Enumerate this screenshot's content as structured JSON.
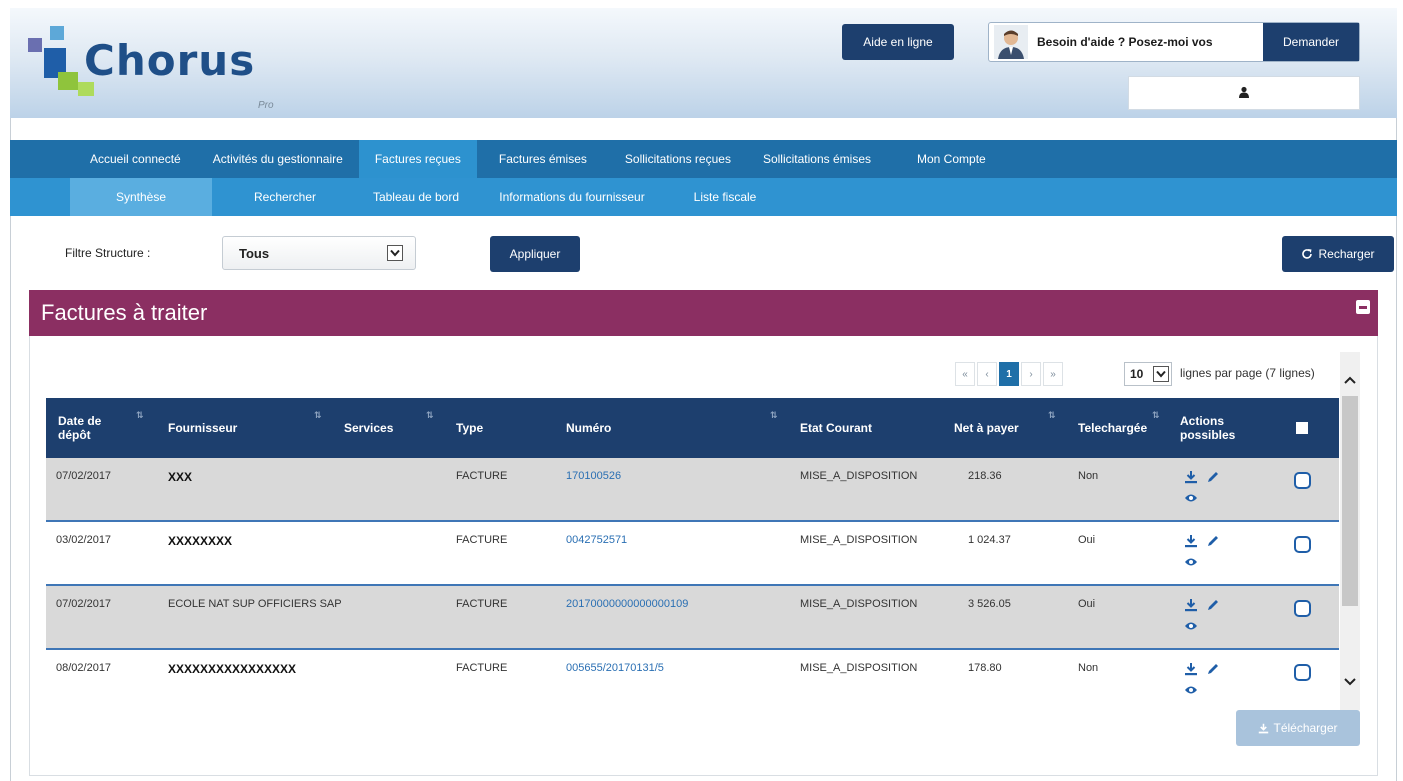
{
  "header": {
    "logo_word": "Chorus",
    "logo_sub": "Pro",
    "aide_label": "Aide en ligne",
    "help_question": "Besoin d'aide ? Posez-moi vos",
    "ask_label": "Demander"
  },
  "nav_primary": [
    {
      "label": "Accueil connecté",
      "active": false
    },
    {
      "label": "Activités du gestionnaire",
      "active": false
    },
    {
      "label": "Factures reçues",
      "active": true
    },
    {
      "label": "Factures émises",
      "active": false
    },
    {
      "label": "Sollicitations reçues",
      "active": false
    },
    {
      "label": "Sollicitations émises",
      "active": false
    },
    {
      "label": "Mon Compte",
      "active": false
    }
  ],
  "nav_secondary": [
    {
      "label": "Synthèse",
      "active": true
    },
    {
      "label": "Rechercher",
      "active": false
    },
    {
      "label": "Tableau de bord",
      "active": false
    },
    {
      "label": "Informations du fournisseur",
      "active": false
    },
    {
      "label": "Liste fiscale",
      "active": false
    }
  ],
  "filter": {
    "label": "Filtre Structure :",
    "value": "Tous",
    "apply_label": "Appliquer",
    "reload_label": "Recharger"
  },
  "panel": {
    "title": "Factures à traiter"
  },
  "pagination": {
    "current_page": "1",
    "per_page": "10",
    "per_page_label": "lignes par page (7 lignes)"
  },
  "table": {
    "headers": {
      "date": "Date de dépôt",
      "fournisseur": "Fournisseur",
      "services": "Services",
      "type": "Type",
      "numero": "Numéro",
      "etat": "Etat Courant",
      "net": "Net à payer",
      "telechargee": "Telechargée",
      "actions": "Actions possibles"
    },
    "rows": [
      {
        "date": "07/02/2017",
        "fournisseur": "XXX",
        "type": "FACTURE",
        "numero": "170100526",
        "etat": "MISE_A_DISPOSITION",
        "net": "218.36",
        "telechargee": "Non"
      },
      {
        "date": "03/02/2017",
        "fournisseur": "XXXXXXXX",
        "type": "FACTURE",
        "numero": "0042752571",
        "etat": "MISE_A_DISPOSITION",
        "net": "1 024.37",
        "telechargee": "Oui"
      },
      {
        "date": "07/02/2017",
        "fournisseur": "ECOLE NAT SUP OFFICIERS SAP",
        "type": "FACTURE",
        "numero": "20170000000000000109",
        "etat": "MISE_A_DISPOSITION",
        "net": "3 526.05",
        "telechargee": "Oui"
      },
      {
        "date": "08/02/2017",
        "fournisseur": "XXXXXXXXXXXXXXXX",
        "type": "FACTURE",
        "numero": "005655/20170131/5",
        "etat": "MISE_A_DISPOSITION",
        "net": "178.80",
        "telechargee": "Non"
      }
    ]
  },
  "download_label": "Télécharger",
  "colors": {
    "nav_primary": "#1f6fa8",
    "nav_secondary": "#2f93d1",
    "panel_head": "#8b2f62",
    "table_head": "#1d3f6e",
    "link": "#2a6fb3"
  }
}
